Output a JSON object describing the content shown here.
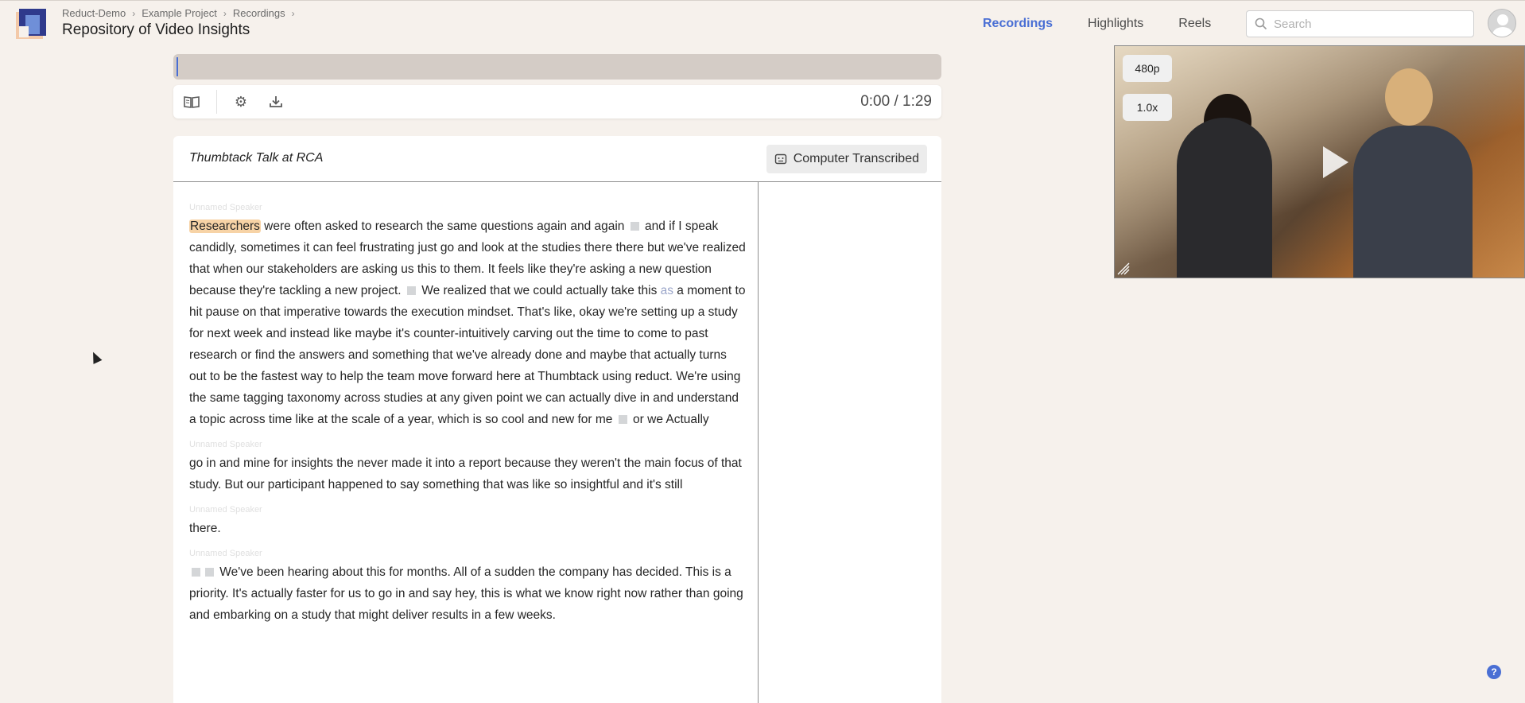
{
  "header": {
    "breadcrumb": [
      "Reduct-Demo",
      "Example Project",
      "Recordings"
    ],
    "title": "Repository of Video Insights",
    "nav": [
      {
        "label": "Recordings",
        "active": true
      },
      {
        "label": "Highlights",
        "active": false
      },
      {
        "label": "Reels",
        "active": false
      }
    ],
    "search_placeholder": "Search",
    "accent_color": "#4a6fd4"
  },
  "player": {
    "time_current": "0:00",
    "time_total": "1:29",
    "time_display": "0:00 / 1:29",
    "tools": [
      "book-icon",
      "gear-icon",
      "download-icon"
    ],
    "progress": 0
  },
  "document": {
    "title": "Thumbtack Talk at RCA",
    "badge": "Computer Transcribed",
    "paragraphs": [
      {
        "speaker": "Unnamed Speaker",
        "highlight": "Researchers",
        "text_a": " were often asked to research the same questions again and again ",
        "text_b": " and if I speak candidly, sometimes it can feel frustrating just go and look at the studies there there but we've realized that when our stakeholders are asking us this to them. It feels like they're asking a new question because they're tackling a new project. ",
        "text_c": " We realized that we could actually take this ",
        "faded": "as",
        "text_d": " a moment to hit pause on that imperative towards the execution mindset. That's like, okay we're setting up a study for next week and instead like maybe it's counter-intuitively carving out the time to come to past research or find the answers and something that we've already done and maybe that actually turns out to be the fastest way to help the team move forward here at Thumbtack using reduct. We're using the same tagging taxonomy across studies at any given point we can actually dive in and understand a topic across time like at the scale of a year, which is so cool and new for me ",
        "text_e": " or we Actually"
      },
      {
        "speaker": "Unnamed Speaker",
        "text": "go in and mine for insights the never made it into a report because they weren't the main focus of that study. But our participant happened to say something that was like so insightful and it's still"
      },
      {
        "speaker": "Unnamed Speaker",
        "text": "there."
      },
      {
        "speaker": "Unnamed Speaker",
        "text": " We've been hearing about this for months. All of a sudden the company has decided. This is a priority. It's actually faster for us to go in and say hey, this is what we know right now rather than going and embarking on a study that might deliver results in a few weeks."
      }
    ]
  },
  "video": {
    "quality": "480p",
    "speed": "1.0x"
  },
  "help": "?"
}
